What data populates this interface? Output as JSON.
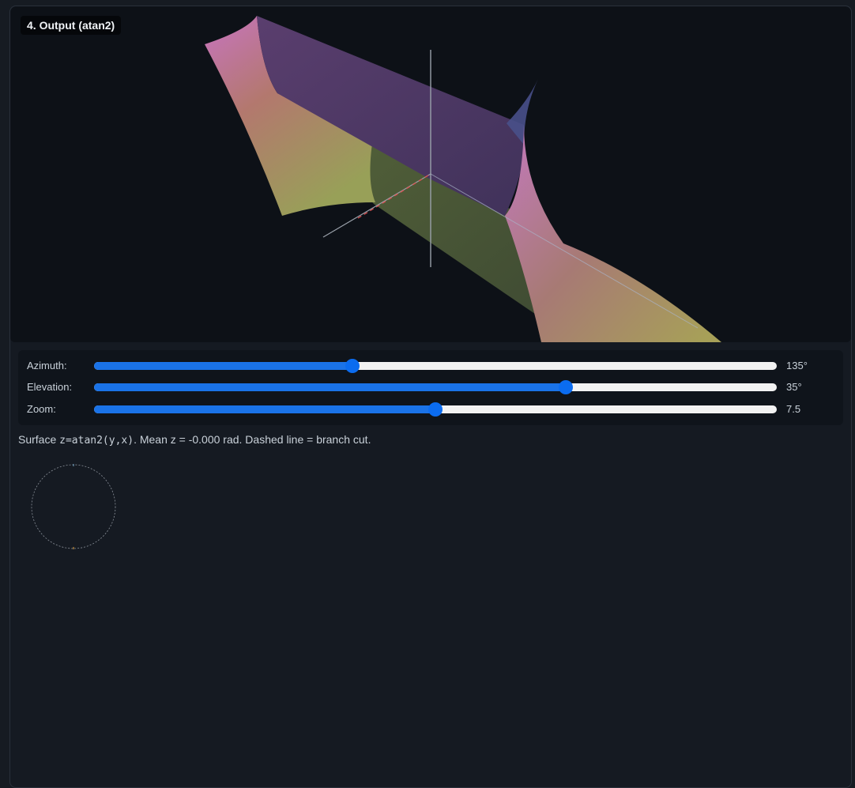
{
  "viewport": {
    "title": "4. Output (atan2)"
  },
  "controls": [
    {
      "label": "Azimuth:",
      "value": "135°",
      "min": 0,
      "max": 360,
      "current": 135
    },
    {
      "label": "Elevation:",
      "value": "35°",
      "min": -90,
      "max": 90,
      "current": 35
    },
    {
      "label": "Zoom:",
      "value": "7.5",
      "min": 0,
      "max": 15,
      "current": 7.5
    }
  ],
  "info": {
    "prefix": "Surface ",
    "formula": "z=atan2(y,x)",
    "suffix": ". Mean z = -0.000 rad. Dashed line = branch cut."
  },
  "colors": {
    "accent": "#1a73e8",
    "surface_pink": "#c06fb6",
    "surface_olive": "#8a9a55",
    "surface_purple": "#4a3560",
    "background": "#0d1117"
  }
}
